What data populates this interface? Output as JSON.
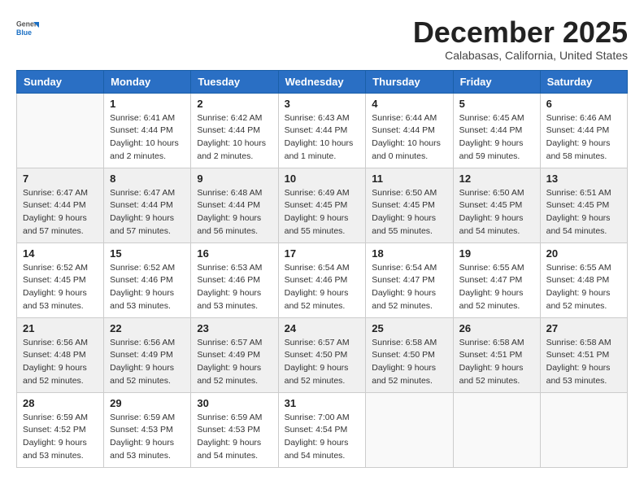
{
  "logo": {
    "general": "General",
    "blue": "Blue"
  },
  "title": "December 2025",
  "subtitle": "Calabasas, California, United States",
  "days_of_week": [
    "Sunday",
    "Monday",
    "Tuesday",
    "Wednesday",
    "Thursday",
    "Friday",
    "Saturday"
  ],
  "weeks": [
    [
      {
        "day": "",
        "empty": true
      },
      {
        "day": "1",
        "sunrise": "6:41 AM",
        "sunset": "4:44 PM",
        "daylight": "10 hours and 2 minutes."
      },
      {
        "day": "2",
        "sunrise": "6:42 AM",
        "sunset": "4:44 PM",
        "daylight": "10 hours and 2 minutes."
      },
      {
        "day": "3",
        "sunrise": "6:43 AM",
        "sunset": "4:44 PM",
        "daylight": "10 hours and 1 minute."
      },
      {
        "day": "4",
        "sunrise": "6:44 AM",
        "sunset": "4:44 PM",
        "daylight": "10 hours and 0 minutes."
      },
      {
        "day": "5",
        "sunrise": "6:45 AM",
        "sunset": "4:44 PM",
        "daylight": "9 hours and 59 minutes."
      },
      {
        "day": "6",
        "sunrise": "6:46 AM",
        "sunset": "4:44 PM",
        "daylight": "9 hours and 58 minutes."
      }
    ],
    [
      {
        "day": "7",
        "sunrise": "6:47 AM",
        "sunset": "4:44 PM",
        "daylight": "9 hours and 57 minutes."
      },
      {
        "day": "8",
        "sunrise": "6:47 AM",
        "sunset": "4:44 PM",
        "daylight": "9 hours and 57 minutes."
      },
      {
        "day": "9",
        "sunrise": "6:48 AM",
        "sunset": "4:44 PM",
        "daylight": "9 hours and 56 minutes."
      },
      {
        "day": "10",
        "sunrise": "6:49 AM",
        "sunset": "4:45 PM",
        "daylight": "9 hours and 55 minutes."
      },
      {
        "day": "11",
        "sunrise": "6:50 AM",
        "sunset": "4:45 PM",
        "daylight": "9 hours and 55 minutes."
      },
      {
        "day": "12",
        "sunrise": "6:50 AM",
        "sunset": "4:45 PM",
        "daylight": "9 hours and 54 minutes."
      },
      {
        "day": "13",
        "sunrise": "6:51 AM",
        "sunset": "4:45 PM",
        "daylight": "9 hours and 54 minutes."
      }
    ],
    [
      {
        "day": "14",
        "sunrise": "6:52 AM",
        "sunset": "4:45 PM",
        "daylight": "9 hours and 53 minutes."
      },
      {
        "day": "15",
        "sunrise": "6:52 AM",
        "sunset": "4:46 PM",
        "daylight": "9 hours and 53 minutes."
      },
      {
        "day": "16",
        "sunrise": "6:53 AM",
        "sunset": "4:46 PM",
        "daylight": "9 hours and 53 minutes."
      },
      {
        "day": "17",
        "sunrise": "6:54 AM",
        "sunset": "4:46 PM",
        "daylight": "9 hours and 52 minutes."
      },
      {
        "day": "18",
        "sunrise": "6:54 AM",
        "sunset": "4:47 PM",
        "daylight": "9 hours and 52 minutes."
      },
      {
        "day": "19",
        "sunrise": "6:55 AM",
        "sunset": "4:47 PM",
        "daylight": "9 hours and 52 minutes."
      },
      {
        "day": "20",
        "sunrise": "6:55 AM",
        "sunset": "4:48 PM",
        "daylight": "9 hours and 52 minutes."
      }
    ],
    [
      {
        "day": "21",
        "sunrise": "6:56 AM",
        "sunset": "4:48 PM",
        "daylight": "9 hours and 52 minutes."
      },
      {
        "day": "22",
        "sunrise": "6:56 AM",
        "sunset": "4:49 PM",
        "daylight": "9 hours and 52 minutes."
      },
      {
        "day": "23",
        "sunrise": "6:57 AM",
        "sunset": "4:49 PM",
        "daylight": "9 hours and 52 minutes."
      },
      {
        "day": "24",
        "sunrise": "6:57 AM",
        "sunset": "4:50 PM",
        "daylight": "9 hours and 52 minutes."
      },
      {
        "day": "25",
        "sunrise": "6:58 AM",
        "sunset": "4:50 PM",
        "daylight": "9 hours and 52 minutes."
      },
      {
        "day": "26",
        "sunrise": "6:58 AM",
        "sunset": "4:51 PM",
        "daylight": "9 hours and 52 minutes."
      },
      {
        "day": "27",
        "sunrise": "6:58 AM",
        "sunset": "4:51 PM",
        "daylight": "9 hours and 53 minutes."
      }
    ],
    [
      {
        "day": "28",
        "sunrise": "6:59 AM",
        "sunset": "4:52 PM",
        "daylight": "9 hours and 53 minutes."
      },
      {
        "day": "29",
        "sunrise": "6:59 AM",
        "sunset": "4:53 PM",
        "daylight": "9 hours and 53 minutes."
      },
      {
        "day": "30",
        "sunrise": "6:59 AM",
        "sunset": "4:53 PM",
        "daylight": "9 hours and 54 minutes."
      },
      {
        "day": "31",
        "sunrise": "7:00 AM",
        "sunset": "4:54 PM",
        "daylight": "9 hours and 54 minutes."
      },
      {
        "day": "",
        "empty": true
      },
      {
        "day": "",
        "empty": true
      },
      {
        "day": "",
        "empty": true
      }
    ]
  ]
}
